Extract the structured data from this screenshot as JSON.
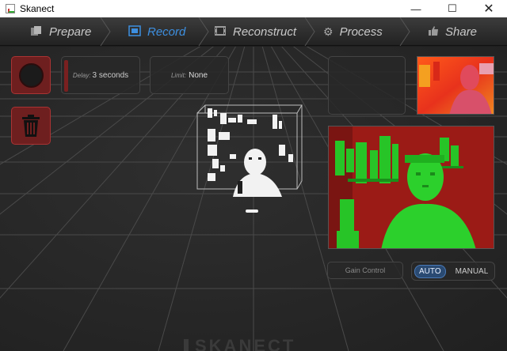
{
  "window": {
    "title": "Skanect",
    "min_glyph": "—",
    "max_glyph": "☐",
    "close_glyph": "✕"
  },
  "nav": {
    "tabs": [
      {
        "label": "Prepare",
        "icon": "prepare-icon",
        "active": false
      },
      {
        "label": "Record",
        "icon": "record-icon",
        "active": true
      },
      {
        "label": "Reconstruct",
        "icon": "film-icon",
        "active": false
      },
      {
        "label": "Process",
        "icon": "gears-icon",
        "active": false
      },
      {
        "label": "Share",
        "icon": "thumbs-up-icon",
        "active": false
      }
    ]
  },
  "record_panel": {
    "record_button_icon": "record-dot-icon",
    "delete_button_icon": "trash-icon",
    "delay_label": "Delay:",
    "delay_value": "3 seconds",
    "limit_label": "Limit:",
    "limit_value": "None"
  },
  "camera_panel": {
    "gain_control_label": "Gain Control",
    "mode_auto": "AUTO",
    "mode_manual": "MANUAL",
    "selected_mode": "AUTO"
  },
  "watermark": "SKANECT",
  "colors": {
    "accent": "#3d8fe0",
    "record_red": "#6e1f1f",
    "depth_green": "#27c427",
    "depth_red": "#9b1b16"
  }
}
